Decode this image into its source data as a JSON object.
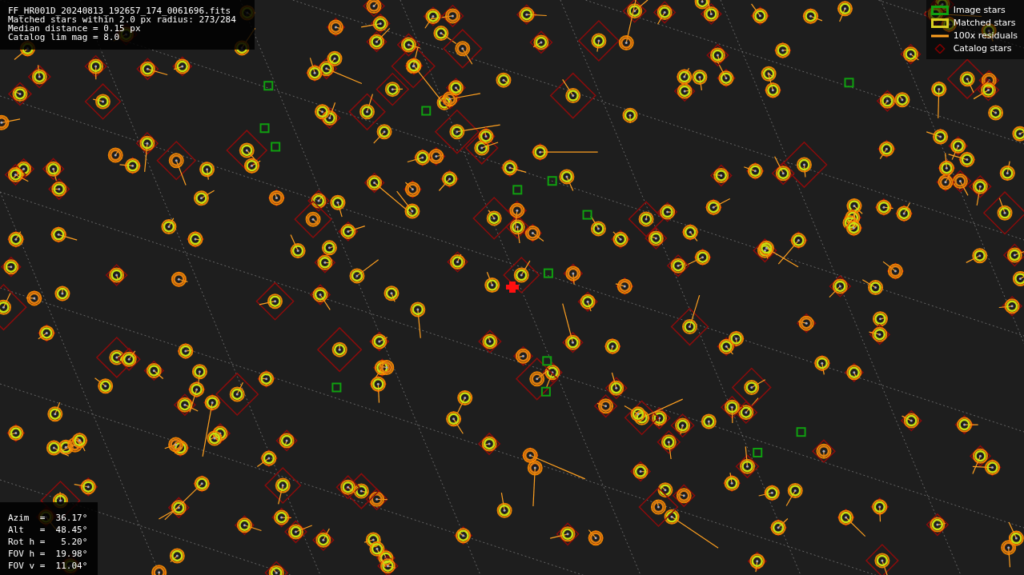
{
  "header": {
    "lines": [
      "FF_HR001D_20240813_192657_174_0061696.fits",
      "Matched stars within 2.0 px radius: 273/284",
      "Median distance = 0.15 px",
      "Catalog lim mag = 8.0"
    ]
  },
  "legend": [
    {
      "kind": "image",
      "label": "Image stars",
      "color": "#10a010"
    },
    {
      "kind": "matched",
      "label": "Matched stars",
      "color": "#d8d020"
    },
    {
      "kind": "residual",
      "label": "100x residuals",
      "color": "#ffa020"
    },
    {
      "kind": "catalog",
      "label": "Catalog stars",
      "color": "#800000"
    }
  ],
  "pointing": [
    "Azim  =  36.17°",
    "Alt   =  48.45°",
    "Rot h =   5.20°",
    "FOV h =  19.98°",
    "FOV v =  11.04°"
  ]
}
